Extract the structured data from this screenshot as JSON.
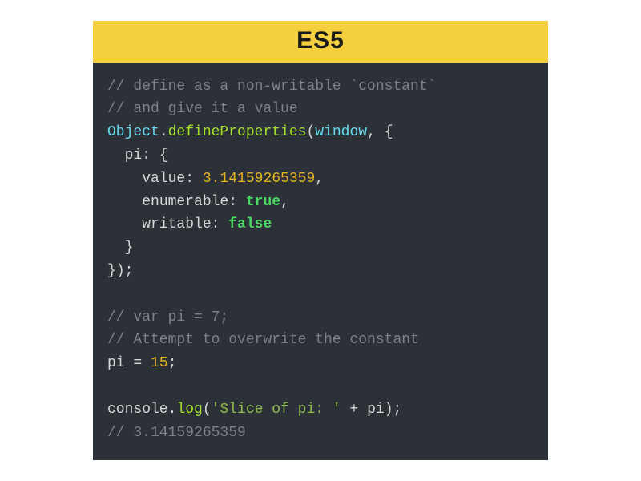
{
  "header": {
    "title": "ES5"
  },
  "code": {
    "c1": "// define as a non-writable `constant`",
    "c2": "// and give it a value",
    "obj_object": "Object",
    "dot": ".",
    "func_define": "defineProperties",
    "lparen": "(",
    "window": "window",
    "comma_sp": ", ",
    "lbrace": "{",
    "indent1": "  ",
    "key_pi": "pi",
    "colon_sp": ": ",
    "indent2": "    ",
    "key_value": "value",
    "num_pi": "3.14159265359",
    "comma": ",",
    "key_enum": "enumerable",
    "bool_true": "true",
    "key_writable": "writable",
    "bool_false": "false",
    "rbrace": "}",
    "rparen_semi": ");",
    "blank": "",
    "c3": "// var pi = 7;",
    "c4": "// Attempt to overwrite the constant",
    "pi_ident": "pi",
    "eq": " = ",
    "num_15": "15",
    "semi": ";",
    "console": "console",
    "log": "log",
    "str_slice": "'Slice of pi: '",
    "plus": " + ",
    "c5": "// 3.14159265359"
  }
}
